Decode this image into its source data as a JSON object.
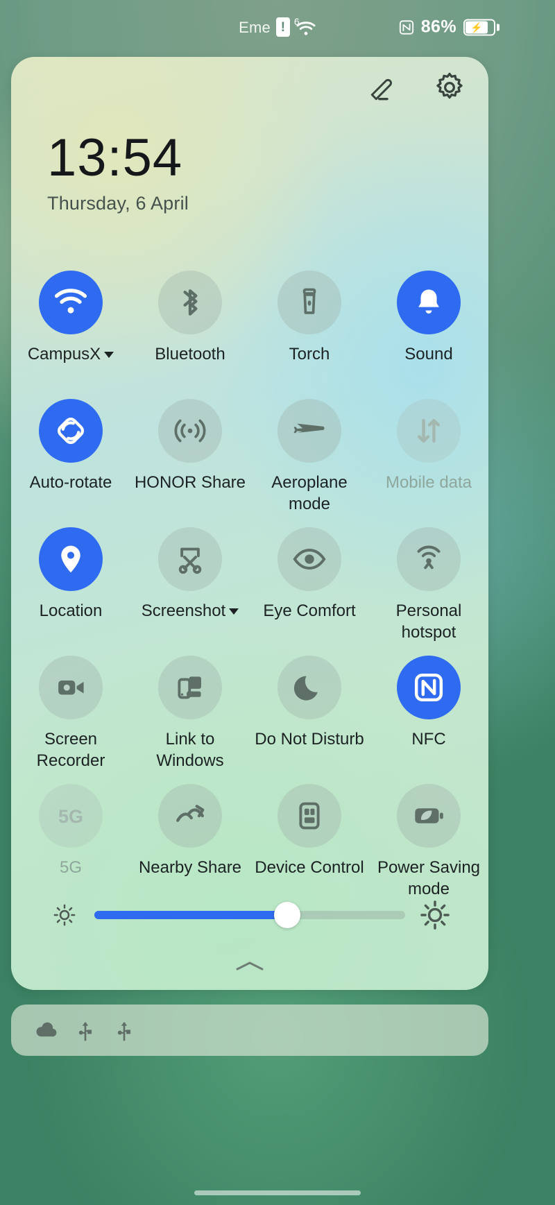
{
  "statusbar": {
    "carrier_text": "Eme",
    "alert_glyph": "!",
    "wifi_generation": "6",
    "wifi_icon": "wifi-icon",
    "nfc_icon": "nfc-icon",
    "battery_percent": "86%",
    "battery_state": "charging",
    "battery_icon": "battery-charging-icon"
  },
  "panel": {
    "header": {
      "edit_icon": "pencil-edit-icon",
      "settings_icon": "gear-icon"
    },
    "clock": {
      "time": "13:54",
      "date": "Thursday, 6 April"
    },
    "tiles": [
      {
        "label": "CampusX",
        "icon": "wifi-icon",
        "state": "on",
        "has_caret": true
      },
      {
        "label": "Bluetooth",
        "icon": "bluetooth-icon",
        "state": "off",
        "has_caret": false
      },
      {
        "label": "Torch",
        "icon": "torch-icon",
        "state": "off",
        "has_caret": false
      },
      {
        "label": "Sound",
        "icon": "bell-icon",
        "state": "on",
        "has_caret": false
      },
      {
        "label": "Auto-rotate",
        "icon": "auto-rotate-icon",
        "state": "on",
        "has_caret": false
      },
      {
        "label": "HONOR Share",
        "icon": "honor-share-icon",
        "state": "off",
        "has_caret": false
      },
      {
        "label": "Aeroplane mode",
        "icon": "aeroplane-icon",
        "state": "off",
        "has_caret": false
      },
      {
        "label": "Mobile data",
        "icon": "mobile-data-icon",
        "state": "disabled",
        "has_caret": false
      },
      {
        "label": "Location",
        "icon": "location-pin-icon",
        "state": "on",
        "has_caret": false
      },
      {
        "label": "Screenshot",
        "icon": "scissors-icon",
        "state": "off",
        "has_caret": true
      },
      {
        "label": "Eye Comfort",
        "icon": "eye-icon",
        "state": "off",
        "has_caret": false
      },
      {
        "label": "Personal hotspot",
        "icon": "hotspot-icon",
        "state": "off",
        "has_caret": false
      },
      {
        "label": "Screen Recorder",
        "icon": "video-camera-icon",
        "state": "off",
        "has_caret": false
      },
      {
        "label": "Link to Windows",
        "icon": "link-windows-icon",
        "state": "off",
        "has_caret": false
      },
      {
        "label": "Do Not Disturb",
        "icon": "moon-icon",
        "state": "off",
        "has_caret": false
      },
      {
        "label": "NFC",
        "icon": "nfc-icon",
        "state": "on",
        "has_caret": false
      },
      {
        "label": "5G",
        "icon": "five-g-icon",
        "state": "disabled",
        "has_caret": false
      },
      {
        "label": "Nearby Share",
        "icon": "nearby-share-icon",
        "state": "off",
        "has_caret": false
      },
      {
        "label": "Device Control",
        "icon": "device-control-icon",
        "state": "off",
        "has_caret": false
      },
      {
        "label": "Power Saving mode",
        "icon": "leaf-battery-icon",
        "state": "off",
        "has_caret": false
      }
    ],
    "brightness": {
      "low_icon": "brightness-low-icon",
      "high_icon": "brightness-high-icon",
      "value_percent": 62
    },
    "collapse_icon": "chevron-up-icon"
  },
  "notifications": {
    "icons": [
      "cloud-icon",
      "usb-icon",
      "usb-icon"
    ]
  },
  "colors": {
    "accent_blue": "#2f6bf0",
    "tile_off": "rgba(160,180,172,0.38)",
    "text_primary": "#1c2224",
    "text_dim": "#8ea69c"
  }
}
